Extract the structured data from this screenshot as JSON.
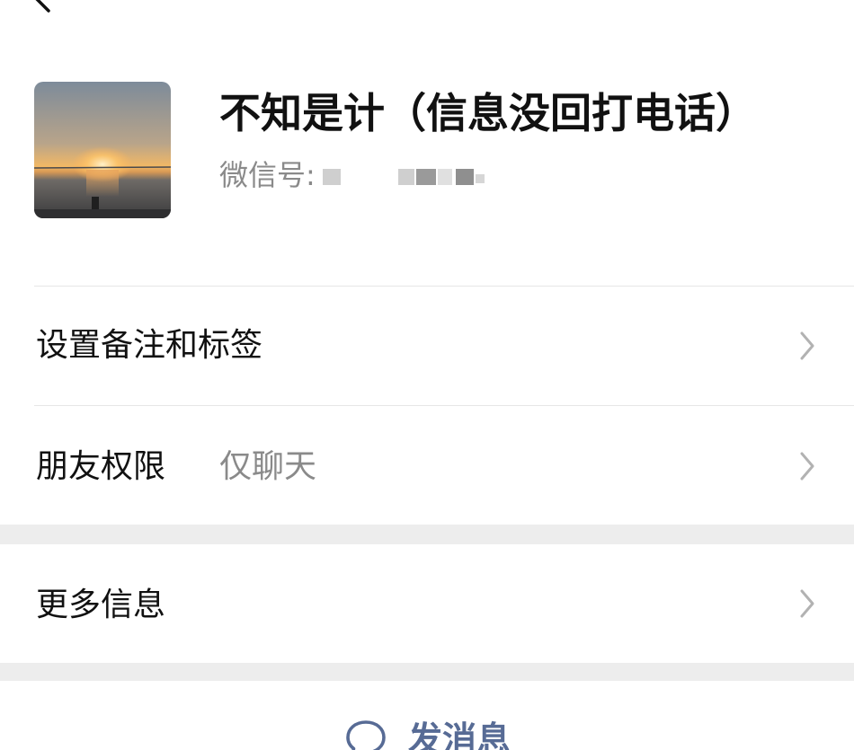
{
  "header": {
    "back_icon": "back-chevron-icon"
  },
  "profile": {
    "nickname": "不知是计（信息没回打电话）",
    "wechat_id_label": "微信号:",
    "wechat_id_value_redacted": true,
    "avatar_description_icon": "sunset-avatar-image"
  },
  "settings": {
    "remark_tags": {
      "label": "设置备注和标签"
    },
    "friend_permission": {
      "label": "朋友权限",
      "value": "仅聊天"
    },
    "more_info": {
      "label": "更多信息"
    }
  },
  "actions": {
    "send_message_label": "发消息",
    "send_message_icon": "chat-bubble-icon"
  },
  "colors": {
    "background": "#ffffff",
    "section_gap": "#ededed",
    "divider": "#e6e6e6",
    "primary_text": "#111111",
    "secondary_text": "#8a8a8a",
    "link_blue": "#576b95",
    "chevron": "#b2b2b2"
  }
}
